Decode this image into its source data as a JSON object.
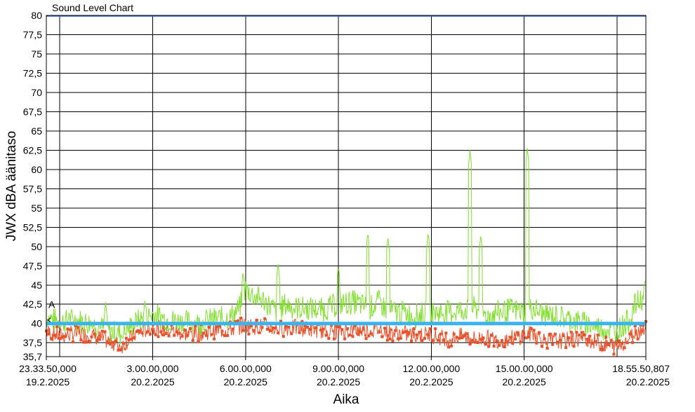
{
  "chart_data": {
    "type": "line",
    "title": "Sound Level Chart",
    "xlabel": "Aika",
    "ylabel": "JWX dBA äänitaso",
    "ylim": [
      35.7,
      80
    ],
    "yticks": [
      "80",
      "77,5",
      "75",
      "72,5",
      "70",
      "67,5",
      "65",
      "62,5",
      "60",
      "57,5",
      "55",
      "52,5",
      "50",
      "47,5",
      "45",
      "42,5",
      "40",
      "37,5",
      "35,7"
    ],
    "xticks": [
      {
        "time": "23.33.50,000",
        "date": "19.2.2025"
      },
      {
        "time": "3.00.00,000",
        "date": "20.2.2025"
      },
      {
        "time": "6.00.00,000",
        "date": "20.2.2025"
      },
      {
        "time": "9.00.00,000",
        "date": "20.2.2025"
      },
      {
        "time": "12.00.00,000",
        "date": "20.2.2025"
      },
      {
        "time": "15.00.00,000",
        "date": "20.2.2025"
      },
      {
        "time": "18.55.50,807",
        "date": "20.2.2025"
      }
    ],
    "x_range_hours": [
      -0.436,
      18.931
    ],
    "x_tick_hours": [
      -0.436,
      3,
      6,
      9,
      12,
      15,
      18.931
    ],
    "x_grid_hours": [
      0,
      3,
      6,
      9,
      12,
      15,
      18
    ],
    "grid": true,
    "reference_line": {
      "value": 40,
      "label": "A",
      "color": "#3ab4ef"
    },
    "series": [
      {
        "color": "#7fe02a",
        "x_hours": [
          -0.4,
          0.0,
          0.5,
          1.0,
          1.5,
          2.0,
          2.5,
          3.0,
          3.5,
          4.0,
          4.5,
          5.0,
          5.5,
          5.8,
          6.0,
          6.3,
          6.6,
          7.0,
          7.3,
          7.6,
          8.0,
          8.5,
          9.0,
          9.5,
          10.0,
          10.3,
          10.6,
          11.0,
          11.5,
          11.9,
          12.2,
          12.6,
          13.0,
          13.4,
          13.8,
          14.2,
          14.6,
          15.0,
          15.3,
          15.6,
          16.0,
          16.5,
          17.0,
          17.5,
          18.0,
          18.4,
          18.6,
          18.8,
          18.93
        ],
        "values": [
          40.8,
          40.2,
          40.5,
          40.0,
          39.2,
          38.6,
          40.3,
          41.2,
          40.5,
          40.2,
          40.0,
          40.6,
          40.8,
          42.0,
          44.5,
          43.5,
          43.0,
          41.5,
          42.5,
          42.0,
          42.0,
          41.8,
          42.5,
          42.8,
          42.0,
          42.8,
          41.6,
          41.5,
          41.0,
          41.5,
          41.4,
          41.5,
          41.8,
          42.0,
          41.0,
          41.5,
          41.8,
          41.5,
          42.0,
          41.2,
          41.0,
          40.5,
          40.0,
          39.4,
          39.0,
          40.5,
          42.5,
          43.2,
          44.0
        ],
        "peaks": [
          {
            "x_hours": 0.3,
            "value": 41.5
          },
          {
            "x_hours": 1.48,
            "value": 42.8
          },
          {
            "x_hours": 2.75,
            "value": 43.0
          },
          {
            "x_hours": 5.92,
            "value": 46.8
          },
          {
            "x_hours": 7.05,
            "value": 47.8
          },
          {
            "x_hours": 9.0,
            "value": 47.5
          },
          {
            "x_hours": 9.95,
            "value": 51.8
          },
          {
            "x_hours": 10.6,
            "value": 51.2
          },
          {
            "x_hours": 11.9,
            "value": 51.8
          },
          {
            "x_hours": 13.25,
            "value": 62.5
          },
          {
            "x_hours": 13.6,
            "value": 51.5
          },
          {
            "x_hours": 15.1,
            "value": 62.8
          },
          {
            "x_hours": 18.9,
            "value": 45.8
          }
        ]
      },
      {
        "color": "#e8512a",
        "marker": "square",
        "x_hours": [
          -0.4,
          0.0,
          0.5,
          1.0,
          1.5,
          2.0,
          2.5,
          3.0,
          3.5,
          4.0,
          4.5,
          5.0,
          5.5,
          5.8,
          6.0,
          6.3,
          6.6,
          7.0,
          7.3,
          7.6,
          8.0,
          8.5,
          9.0,
          9.5,
          10.0,
          10.3,
          10.6,
          11.0,
          11.5,
          11.9,
          12.2,
          12.6,
          13.0,
          13.4,
          13.8,
          14.2,
          14.6,
          15.0,
          15.3,
          15.6,
          16.0,
          16.5,
          17.0,
          17.5,
          18.0,
          18.4,
          18.6,
          18.8,
          18.93
        ],
        "values": [
          38.9,
          38.4,
          38.7,
          38.5,
          37.8,
          37.1,
          38.8,
          39.5,
          39.2,
          38.7,
          38.7,
          39.1,
          39.2,
          39.6,
          39.8,
          39.6,
          39.7,
          39.3,
          39.4,
          39.5,
          39.3,
          39.1,
          39.0,
          39.2,
          39.1,
          39.3,
          38.9,
          38.7,
          38.5,
          38.6,
          38.3,
          38.0,
          38.4,
          38.0,
          38.1,
          37.8,
          38.1,
          38.4,
          38.8,
          37.9,
          37.7,
          37.9,
          38.1,
          37.3,
          37.0,
          38.1,
          39.0,
          39.2,
          39.8
        ]
      }
    ]
  }
}
